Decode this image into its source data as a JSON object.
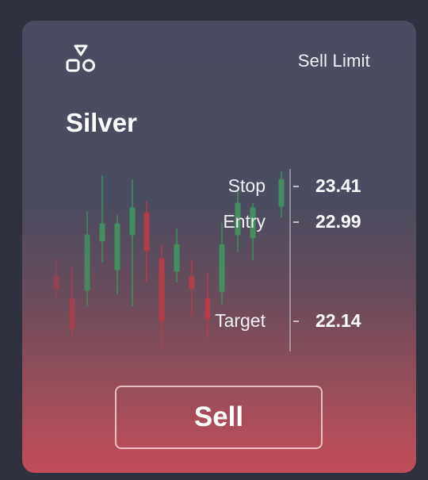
{
  "header": {
    "logo_icon": "shapes-icon",
    "order_type": "Sell Limit"
  },
  "asset": {
    "name": "Silver"
  },
  "levels": [
    {
      "label": "Stop",
      "value": "23.41"
    },
    {
      "label": "Entry",
      "value": "22.99"
    },
    {
      "label": "Target",
      "value": "22.14"
    }
  ],
  "action": {
    "label": "Sell"
  },
  "colors": {
    "candle_up": "#3f9a62",
    "candle_down": "#c23a48",
    "card_top": "#4a4d61",
    "card_bottom": "#c34d5a"
  }
}
